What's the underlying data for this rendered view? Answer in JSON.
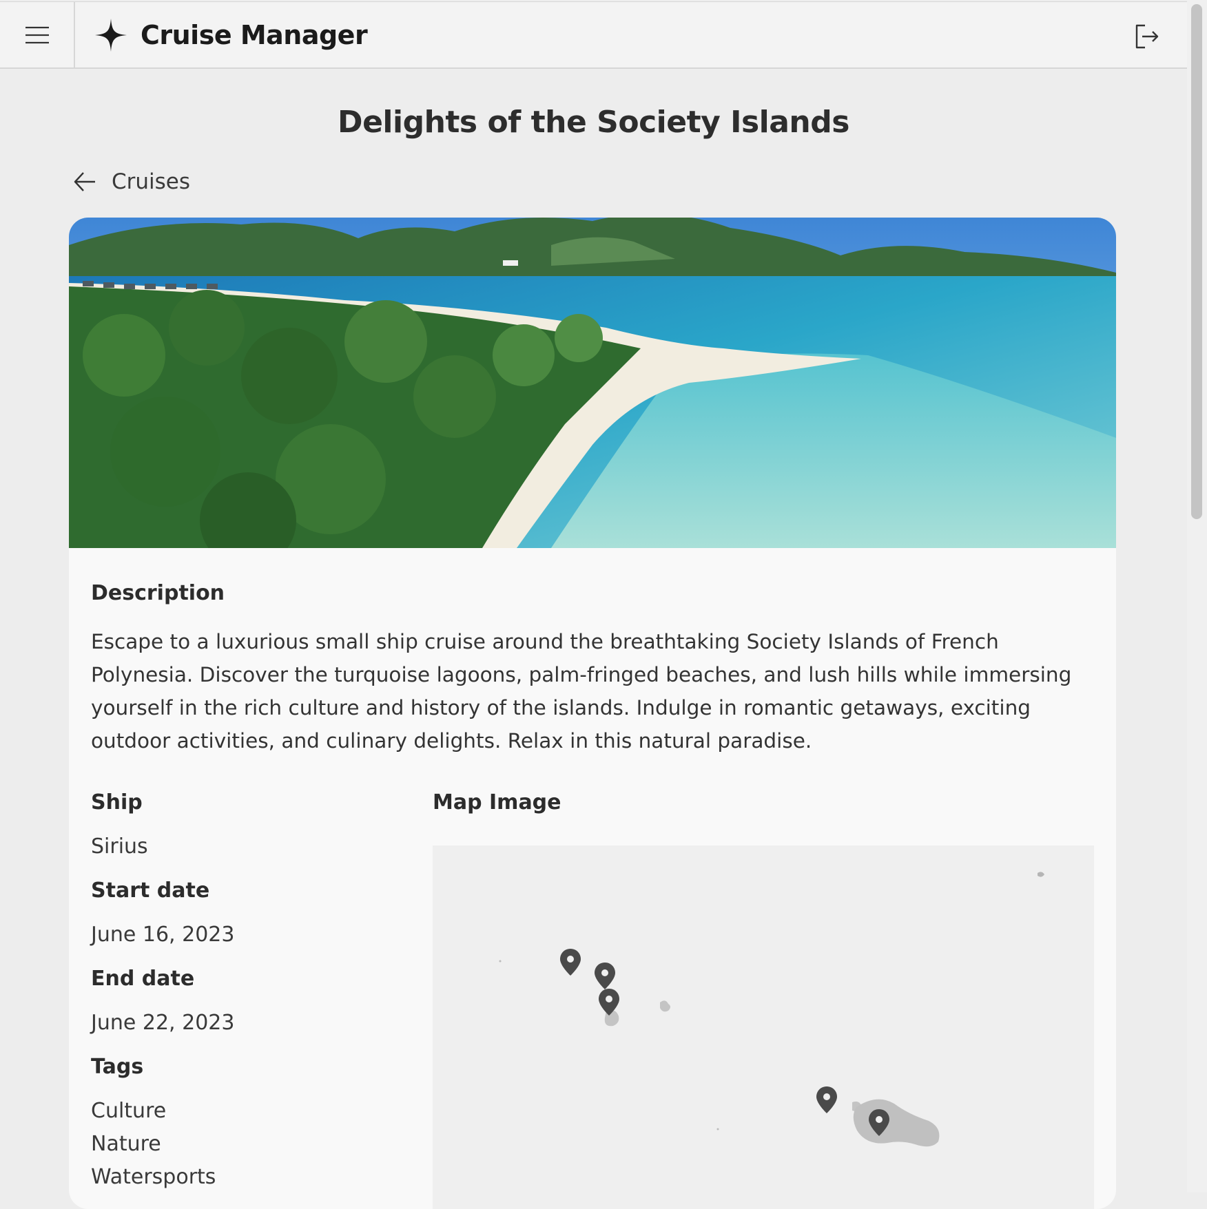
{
  "header": {
    "app_title": "Cruise Manager"
  },
  "page": {
    "title": "Delights of the Society Islands",
    "back_label": "Cruises"
  },
  "details": {
    "description_label": "Description",
    "description": "Escape to a luxurious small ship cruise around the breathtaking Society Islands of French Polynesia. Discover the turquoise lagoons, palm-fringed beaches, and lush hills while immersing yourself in the rich culture and history of the islands. Indulge in romantic getaways, exciting outdoor activities, and culinary delights. Relax in this natural paradise.",
    "ship_label": "Ship",
    "ship": "Sirius",
    "start_label": "Start date",
    "start_date": "June 16, 2023",
    "end_label": "End date",
    "end_date": "June 22, 2023",
    "tags_label": "Tags",
    "tags": [
      "Culture",
      "Nature",
      "Watersports"
    ],
    "map_label": "Map Image"
  },
  "icons": {
    "menu": "menu-icon",
    "logo": "sparkle-icon",
    "logout": "logout-icon",
    "back": "arrow-left-icon",
    "map_pin": "map-pin-icon"
  },
  "colors": {
    "header_bg": "#f3f3f3",
    "page_bg": "#ededed",
    "card_bg": "#f9f9f9",
    "map_bg": "#efefef",
    "pin": "#4a4a4a"
  }
}
